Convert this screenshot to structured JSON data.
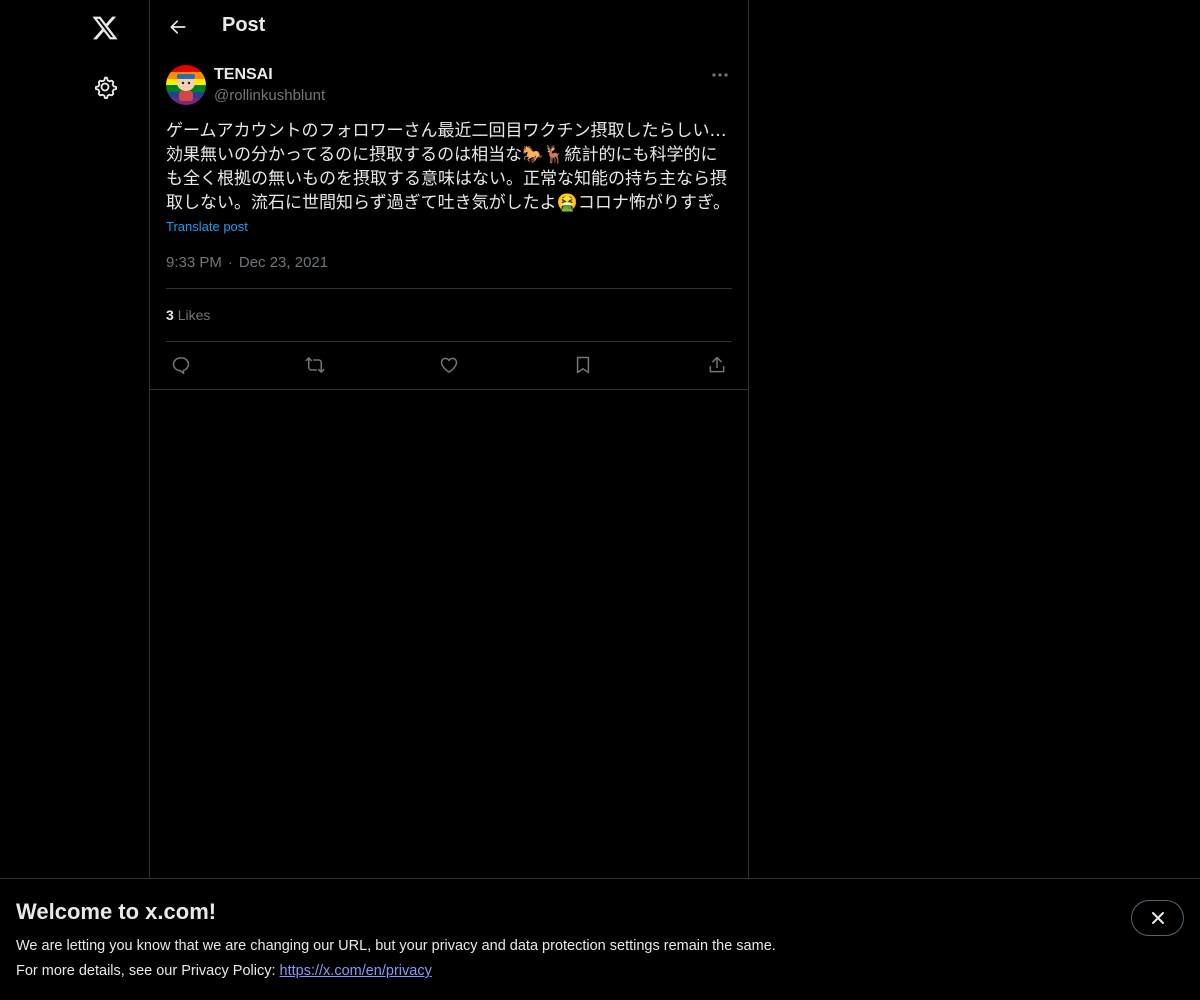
{
  "nav": {
    "logo_icon": "x-logo-icon",
    "settings_icon": "gear-icon"
  },
  "header": {
    "title": "Post",
    "back_icon": "arrow-left-icon"
  },
  "post": {
    "author_name": "TENSAI",
    "author_handle": "@rollinkushblunt",
    "text": "ゲームアカウントのフォロワーさん最近二回目ワクチン摂取したらしい…効果無いの分かってるのに摂取するのは相当な🐎🦌統計的にも科学的にも全く根拠の無いものを摂取する意味はない。正常な知能の持ち主なら摂取しない。流石に世間知らず過ぎて吐き気がしたよ🤮コロナ怖がりすぎ。",
    "translate_label": "Translate post",
    "time": "9:33 PM",
    "separator": "·",
    "date": "Dec 23, 2021",
    "likes_count": "3",
    "likes_label": "Likes"
  },
  "actions": [
    "reply-icon",
    "repost-icon",
    "like-icon",
    "bookmark-icon",
    "share-icon"
  ],
  "banner": {
    "title": "Welcome to x.com!",
    "line1": "We are letting you know that we are changing our URL, but your privacy and data protection settings remain the same.",
    "line2_prefix": "For more details, see our Privacy Policy: ",
    "link": "https://x.com/en/privacy"
  },
  "colors": {
    "background": "#000000",
    "text_primary": "#e7e9ea",
    "text_secondary": "#71767b",
    "accent": "#1d9bf0",
    "border": "#2f3336"
  }
}
